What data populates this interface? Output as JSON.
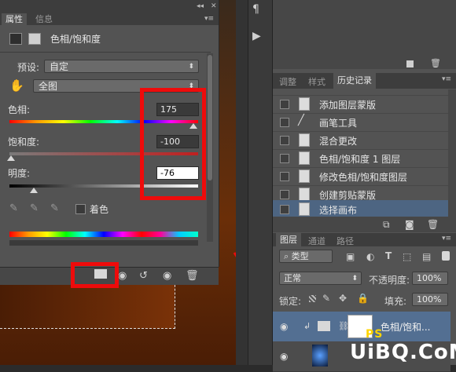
{
  "properties_panel": {
    "tabs": [
      "属性",
      "信息"
    ],
    "collapse_glyph": "◂◂",
    "close_glyph": "✕",
    "menu_glyph": "▾≡",
    "title": "色相/饱和度",
    "preset_label": "预设:",
    "preset_value": "自定",
    "channel_value": "全图",
    "hue_label": "色相:",
    "hue_value": "175",
    "saturation_label": "饱和度:",
    "saturation_value": "-100",
    "lightness_label": "明度:",
    "lightness_value": "-76",
    "colorize_label": "着色"
  },
  "history_panel": {
    "tabs": [
      "调整",
      "样式",
      "历史记录"
    ],
    "items": [
      {
        "label": "添加图层蒙版",
        "icon": "document-icon"
      },
      {
        "label": "画笔工具",
        "icon": "brush-icon"
      },
      {
        "label": "混合更改",
        "icon": "document-icon"
      },
      {
        "label": "色相/饱和度 1 图层",
        "icon": "document-icon"
      },
      {
        "label": "修改色相/饱和度图层",
        "icon": "document-icon"
      },
      {
        "label": "创建剪贴蒙版",
        "icon": "document-icon"
      },
      {
        "label": "选择画布",
        "icon": "document-icon",
        "selected": true
      }
    ]
  },
  "layers_panel": {
    "tabs": [
      "图层",
      "通道",
      "路径"
    ],
    "filter_kind": "类型",
    "blend_mode": "正常",
    "opacity_label": "不透明度:",
    "opacity_value": "100%",
    "lock_label": "锁定:",
    "fill_label": "填充:",
    "fill_value": "100%",
    "layers": [
      {
        "name": "色相/饱和...",
        "selected": true
      },
      {
        "name": ""
      }
    ]
  },
  "watermark": {
    "text_a": "PS",
    "text_b": "UiBQ.CoM"
  },
  "colors": {
    "highlight_red": "#ee0b0b",
    "selection_blue": "#4d6582",
    "layer_selected": "#536f92"
  }
}
